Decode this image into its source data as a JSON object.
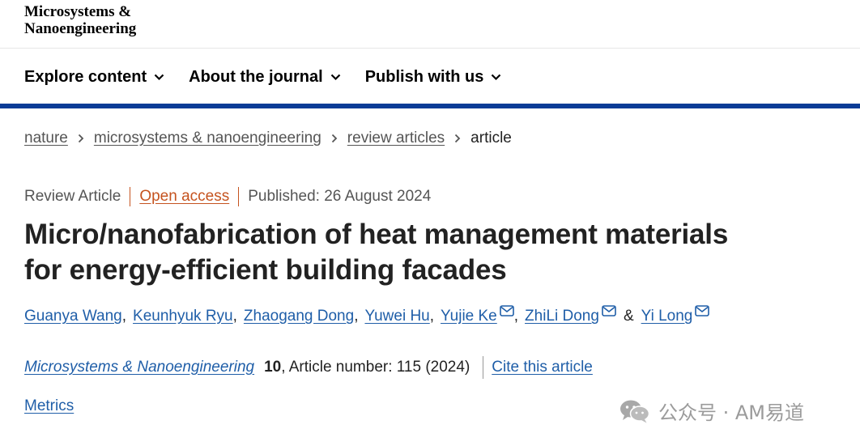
{
  "masthead": {
    "line1": "Microsystems &",
    "line2": "Nanoengineering"
  },
  "nav": {
    "items": [
      {
        "label": "Explore content"
      },
      {
        "label": "About the journal"
      },
      {
        "label": "Publish with us"
      }
    ]
  },
  "breadcrumb": {
    "items": [
      "nature",
      "microsystems & nanoengineering",
      "review articles"
    ],
    "current": "article"
  },
  "meta": {
    "type": "Review Article",
    "access": "Open access",
    "published": "Published: 26 August 2024"
  },
  "article": {
    "title_line1": "Micro/nanofabrication of heat management materials",
    "title_line2": "for energy-efficient building facades"
  },
  "authors": [
    {
      "name": "Guanya Wang",
      "email": false
    },
    {
      "name": "Keunhyuk Ryu",
      "email": false
    },
    {
      "name": "Zhaogang Dong",
      "email": false
    },
    {
      "name": "Yuwei Hu",
      "email": false
    },
    {
      "name": "Yujie Ke",
      "email": true
    },
    {
      "name": "ZhiLi Dong",
      "email": true
    },
    {
      "name": "Yi Long",
      "email": true
    }
  ],
  "authors_separator": ",",
  "authors_conjunction": "&",
  "citation": {
    "journal": "Microsystems & Nanoengineering",
    "volume": "10",
    "rest": ", Article number: 115 (2024)",
    "cite_label": "Cite this article"
  },
  "metrics_label": "Metrics",
  "watermark": {
    "text": "公众号 · AM易道",
    "icon": "wechat-icon"
  },
  "colors": {
    "accent_bar": "#0a3c96",
    "link": "#1f5ea8",
    "open_access": "#c5531f"
  }
}
